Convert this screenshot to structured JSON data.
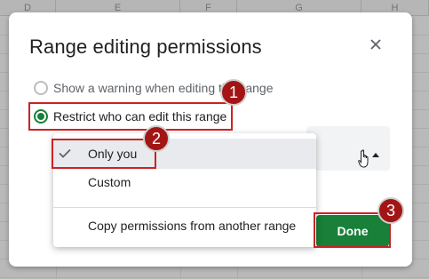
{
  "spreadsheet": {
    "columns": [
      "D",
      "E",
      "F",
      "G",
      "H"
    ]
  },
  "dialog": {
    "title": "Range editing permissions",
    "close_icon": "close-icon",
    "options": [
      {
        "label": "Show a warning when editing this range",
        "checked": false
      },
      {
        "label": "Restrict who can edit this range",
        "checked": true
      }
    ],
    "done_label": "Done"
  },
  "menu": {
    "items": [
      {
        "label": "Only you",
        "selected": true
      },
      {
        "label": "Custom",
        "selected": false
      },
      {
        "label": "Copy permissions from another range",
        "selected": false
      }
    ]
  },
  "annotations": {
    "badges": [
      "1",
      "2",
      "3"
    ]
  },
  "colors": {
    "accent_green": "#188038",
    "annotation_red": "#cc2222",
    "badge_red": "#a31515"
  }
}
